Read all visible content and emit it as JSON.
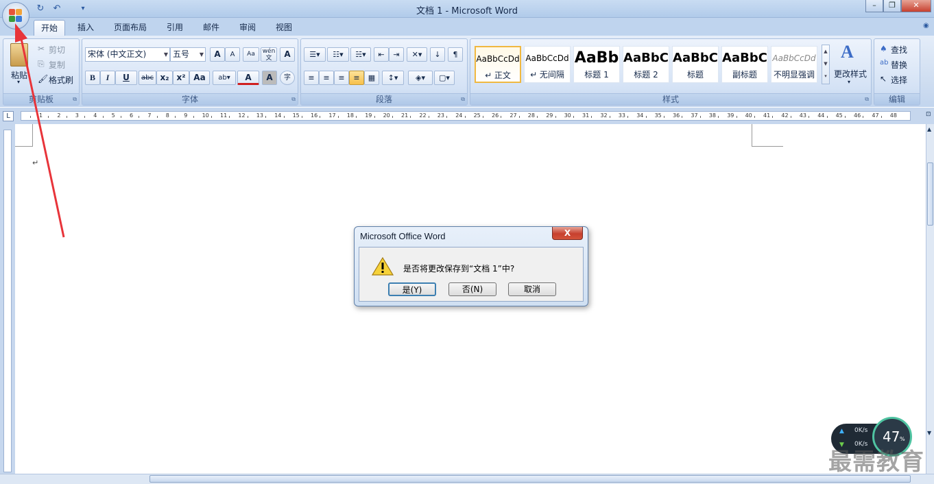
{
  "window": {
    "title": "文档 1 - Microsoft Word",
    "controls": {
      "minimize": "–",
      "restore": "❐",
      "close": "✕"
    }
  },
  "qat": {
    "redo_icon": "redo-icon",
    "undo_icon": "undo-icon",
    "customize": "▾"
  },
  "tabs": [
    {
      "label": "开始",
      "active": true
    },
    {
      "label": "插入"
    },
    {
      "label": "页面布局"
    },
    {
      "label": "引用"
    },
    {
      "label": "邮件"
    },
    {
      "label": "审阅"
    },
    {
      "label": "视图"
    }
  ],
  "clipboard": {
    "group": "剪贴板",
    "paste": "粘贴",
    "cut": "剪切",
    "copy": "复制",
    "format_painter": "格式刷"
  },
  "font": {
    "group": "字体",
    "name": "宋体 (中文正文)",
    "size": "五号",
    "bold": "B",
    "italic": "I",
    "underline": "U",
    "strike": "abc",
    "subscript": "x₂",
    "superscript": "x²",
    "change_case": "Aa",
    "grow": "A",
    "shrink": "A",
    "phonetic": "wén",
    "phonetic_char": "文",
    "border_char": "A",
    "font_color": "A",
    "shade_char": "A",
    "enclose": "字"
  },
  "paragraph": {
    "group": "段落"
  },
  "styles": {
    "group": "样式",
    "change_styles": "更改样式",
    "items": [
      {
        "sample": "AaBbCcDd",
        "name": "↵ 正文"
      },
      {
        "sample": "AaBbCcDd",
        "name": "↵ 无间隔"
      },
      {
        "sample": "AaBb",
        "name": "标题 1"
      },
      {
        "sample": "AaBbC",
        "name": "标题 2"
      },
      {
        "sample": "AaBbC",
        "name": "标题"
      },
      {
        "sample": "AaBbC",
        "name": "副标题"
      },
      {
        "sample": "AaBbCcDd",
        "name": "不明显强调"
      }
    ]
  },
  "editing": {
    "group": "编辑",
    "find": "查找",
    "replace": "替换",
    "select": "选择"
  },
  "ruler": {
    "ticks": [
      "1",
      "2",
      "3",
      "4",
      "5",
      "6",
      "7",
      "8",
      "9",
      "10",
      "11",
      "12",
      "13",
      "14",
      "15",
      "16",
      "17",
      "18",
      "19",
      "20",
      "21",
      "22",
      "23",
      "24",
      "25",
      "26",
      "27",
      "28",
      "29",
      "30",
      "31",
      "32",
      "33",
      "34",
      "35",
      "36",
      "37",
      "38",
      "39",
      "40",
      "41",
      "42",
      "43",
      "44",
      "45",
      "46",
      "47",
      "48"
    ]
  },
  "document": {
    "paragraph_mark": "↵"
  },
  "dialog": {
    "title": "Microsoft Office Word",
    "close": "X",
    "message": "是否将更改保存到“文档 1”中?",
    "buttons": [
      "是(Y)",
      "否(N)",
      "取消"
    ]
  },
  "net_widget": {
    "up": "0K/s",
    "down": "0K/s",
    "percent": "47",
    "percent_unit": "%"
  },
  "watermark": "最需教育",
  "colors": {
    "accent": "#1e395b",
    "arrow": "#e8343a",
    "close_red": "#c7402e"
  }
}
